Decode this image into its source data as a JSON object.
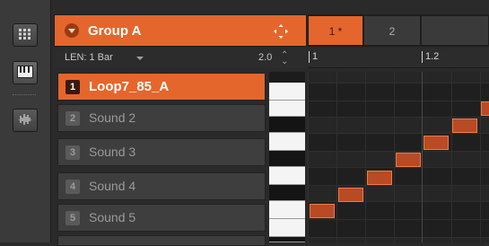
{
  "sidebar": {
    "buttons": [
      {
        "icon": "grid-view-icon"
      },
      {
        "icon": "keyboard-icon"
      },
      {
        "icon": "waveform-icon"
      }
    ]
  },
  "group": {
    "title": "Group A",
    "accent": "#e4662d"
  },
  "patterns": {
    "tabs": [
      {
        "label": "1 *",
        "active": true
      },
      {
        "label": "2",
        "active": false
      }
    ]
  },
  "length": {
    "label": "LEN: 1 Bar",
    "zoom_value": "2.0",
    "spin_symbol": "⌃\n⌄"
  },
  "ruler": {
    "ticks": [
      "1",
      "1.2"
    ]
  },
  "sounds": [
    {
      "slot": "1",
      "name": "Loop7_85_A",
      "selected": true
    },
    {
      "slot": "2",
      "name": "Sound 2",
      "selected": false
    },
    {
      "slot": "3",
      "name": "Sound 3",
      "selected": false
    },
    {
      "slot": "4",
      "name": "Sound 4",
      "selected": false
    },
    {
      "slot": "5",
      "name": "Sound 5",
      "selected": false
    }
  ],
  "piano_roll": {
    "notes": [
      {
        "step": 0,
        "row": 0
      },
      {
        "step": 1,
        "row": 1
      },
      {
        "step": 2,
        "row": 2
      },
      {
        "step": 3,
        "row": 3
      },
      {
        "step": 4,
        "row": 4
      },
      {
        "step": 5,
        "row": 5
      },
      {
        "step": 6,
        "row": 6
      }
    ]
  }
}
